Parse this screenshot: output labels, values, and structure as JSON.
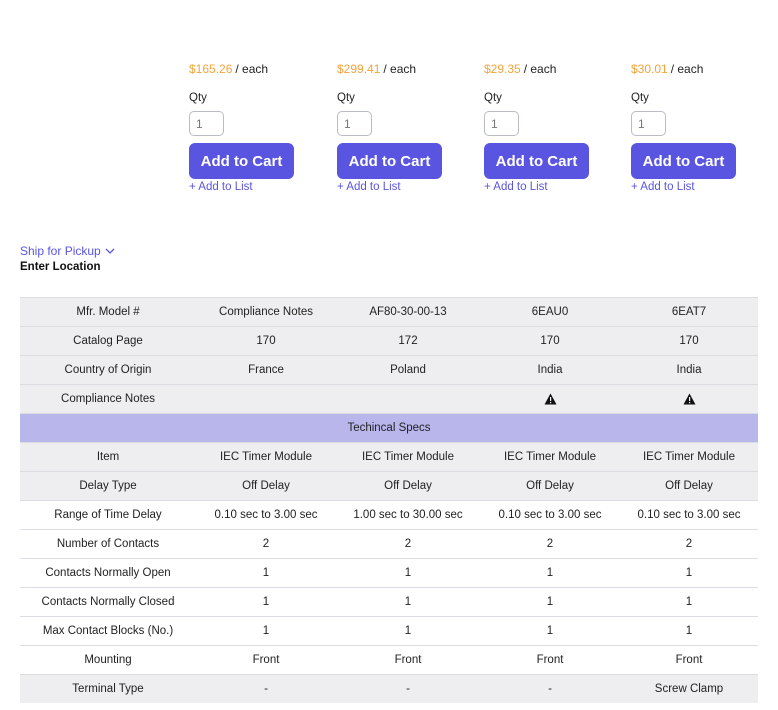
{
  "products": [
    {
      "price": "$165.26",
      "per": "/ each",
      "qty_label": "Qty",
      "qty": "1",
      "add_to_cart": "Add to Cart",
      "add_to_list": "+ Add to List"
    },
    {
      "price": "$299.41",
      "per": "/ each",
      "qty_label": "Qty",
      "qty": "1",
      "add_to_cart": "Add to Cart",
      "add_to_list": "+ Add to List"
    },
    {
      "price": "$29.35",
      "per": "/ each",
      "qty_label": "Qty",
      "qty": "1",
      "add_to_cart": "Add to Cart",
      "add_to_list": "+ Add to List"
    },
    {
      "price": "$30.01",
      "per": "/ each",
      "qty_label": "Qty",
      "qty": "1",
      "add_to_cart": "Add to Cart",
      "add_to_list": "+ Add to List"
    }
  ],
  "pickup": {
    "ship_label": "Ship for Pickup",
    "location_label": "Enter Location"
  },
  "table": {
    "rows_top": [
      [
        "Mfr. Model #",
        "Compliance Notes",
        "AF80-30-00-13",
        "6EAU0",
        "6EAT7"
      ],
      [
        "Catalog Page",
        "170",
        "172",
        "170",
        "170"
      ],
      [
        "Country of Origin",
        "France",
        "Poland",
        "India",
        "India"
      ],
      [
        "Compliance Notes",
        "",
        "",
        "warning-icon",
        "warning-icon"
      ]
    ],
    "section_title": "Techincal Specs",
    "rows_specs": [
      [
        "Item",
        "IEC Timer Module",
        "IEC Timer Module",
        "IEC Timer Module",
        "IEC Timer Module"
      ],
      [
        "Delay Type",
        "Off Delay",
        "Off Delay",
        "Off Delay",
        "Off Delay"
      ],
      [
        "Range of Time Delay",
        "0.10 sec to 3.00 sec",
        "1.00 sec to 30.00 sec",
        "0.10 sec to 3.00 sec",
        "0.10 sec to 3.00 sec"
      ],
      [
        "Number of Contacts",
        "2",
        "2",
        "2",
        "2"
      ],
      [
        "Contacts Normally Open",
        "1",
        "1",
        "1",
        "1"
      ],
      [
        "Contacts Normally Closed",
        "1",
        "1",
        "1",
        "1"
      ],
      [
        "Max Contact Blocks (No.)",
        "1",
        "1",
        "1",
        "1"
      ],
      [
        "Mounting",
        "Front",
        "Front",
        "Front",
        "Front"
      ],
      [
        "Terminal Type",
        "-",
        "-",
        "-",
        "Screw Clamp"
      ]
    ]
  },
  "colors": {
    "accent": "#5a55e0",
    "price": "#f3a43b",
    "section_bg": "#b9b6ec",
    "row_shade": "#eeeef0"
  }
}
